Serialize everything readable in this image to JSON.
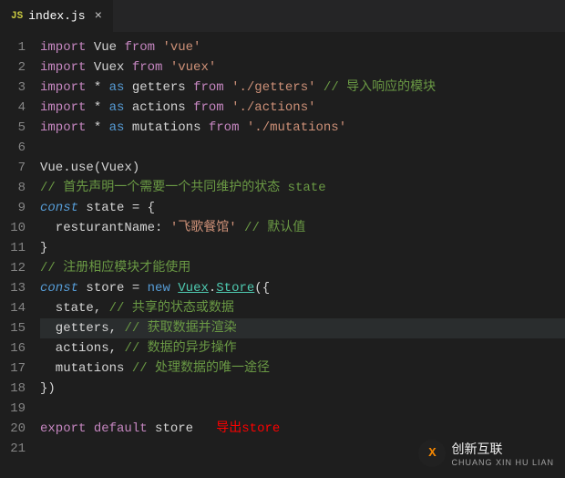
{
  "tab": {
    "icon": "JS",
    "filename": "index.js"
  },
  "lines": [
    {
      "n": 1,
      "tokens": [
        [
          "kw-import",
          "import"
        ],
        [
          "ident",
          " Vue "
        ],
        [
          "kw-import",
          "from"
        ],
        [
          "string",
          " 'vue'"
        ]
      ]
    },
    {
      "n": 2,
      "tokens": [
        [
          "kw-import",
          "import"
        ],
        [
          "ident",
          " Vuex "
        ],
        [
          "kw-import",
          "from"
        ],
        [
          "string",
          " 'vuex'"
        ]
      ]
    },
    {
      "n": 3,
      "tokens": [
        [
          "kw-import",
          "import"
        ],
        [
          "punct",
          " * "
        ],
        [
          "kw-as",
          "as"
        ],
        [
          "ident",
          " getters "
        ],
        [
          "kw-import",
          "from"
        ],
        [
          "string",
          " './getters'"
        ],
        [
          "comment",
          " // 导入响应的模块"
        ]
      ]
    },
    {
      "n": 4,
      "tokens": [
        [
          "kw-import",
          "import"
        ],
        [
          "punct",
          " * "
        ],
        [
          "kw-as",
          "as"
        ],
        [
          "ident",
          " actions "
        ],
        [
          "kw-import",
          "from"
        ],
        [
          "string",
          " './actions'"
        ]
      ]
    },
    {
      "n": 5,
      "tokens": [
        [
          "kw-import",
          "import"
        ],
        [
          "punct",
          " * "
        ],
        [
          "kw-as",
          "as"
        ],
        [
          "ident",
          " mutations "
        ],
        [
          "kw-import",
          "from"
        ],
        [
          "string",
          " './mutations'"
        ]
      ]
    },
    {
      "n": 6,
      "tokens": []
    },
    {
      "n": 7,
      "tokens": [
        [
          "ident",
          "Vue"
        ],
        [
          "punct",
          "."
        ],
        [
          "ident",
          "use"
        ],
        [
          "punct",
          "(Vuex)"
        ]
      ]
    },
    {
      "n": 8,
      "tokens": [
        [
          "comment",
          "// 首先声明一个需要一个共同维护的状态 state"
        ]
      ]
    },
    {
      "n": 9,
      "tokens": [
        [
          "kw-const",
          "const"
        ],
        [
          "ident",
          " state "
        ],
        [
          "punct",
          "= {"
        ]
      ]
    },
    {
      "n": 10,
      "tokens": [
        [
          "ident",
          "  resturantName"
        ],
        [
          "punct",
          ": "
        ],
        [
          "string",
          "'飞歌餐馆'"
        ],
        [
          "comment",
          " // 默认值"
        ]
      ]
    },
    {
      "n": 11,
      "tokens": [
        [
          "punct",
          "}"
        ]
      ]
    },
    {
      "n": 12,
      "tokens": [
        [
          "comment",
          "// 注册相应模块才能使用"
        ]
      ]
    },
    {
      "n": 13,
      "tokens": [
        [
          "kw-const",
          "const"
        ],
        [
          "ident",
          " store "
        ],
        [
          "punct",
          "= "
        ],
        [
          "kw-new",
          "new"
        ],
        [
          "punct",
          " "
        ],
        [
          "class-name",
          "Vuex"
        ],
        [
          "punct",
          "."
        ],
        [
          "prop-store",
          "Store"
        ],
        [
          "punct",
          "({"
        ]
      ]
    },
    {
      "n": 14,
      "tokens": [
        [
          "ident",
          "  state"
        ],
        [
          "punct",
          ", "
        ],
        [
          "comment",
          "// 共享的状态或数据"
        ]
      ]
    },
    {
      "n": 15,
      "highlighted": true,
      "tokens": [
        [
          "ident",
          "  getters"
        ],
        [
          "punct",
          ", "
        ],
        [
          "comment",
          "// 获取数据并渲染"
        ]
      ]
    },
    {
      "n": 16,
      "tokens": [
        [
          "ident",
          "  actions"
        ],
        [
          "punct",
          ", "
        ],
        [
          "comment",
          "// 数据的异步操作"
        ]
      ]
    },
    {
      "n": 17,
      "tokens": [
        [
          "ident",
          "  mutations "
        ],
        [
          "comment",
          "// 处理数据的唯一途径"
        ]
      ]
    },
    {
      "n": 18,
      "tokens": [
        [
          "punct",
          "})"
        ]
      ]
    },
    {
      "n": 19,
      "tokens": []
    },
    {
      "n": 20,
      "tokens": [
        [
          "kw-export",
          "export"
        ],
        [
          "punct",
          " "
        ],
        [
          "kw-export",
          "default"
        ],
        [
          "ident",
          " store   "
        ],
        [
          "annot",
          "导出store"
        ]
      ]
    },
    {
      "n": 21,
      "tokens": []
    }
  ],
  "watermark": {
    "logo_text": "X",
    "brand": "创新互联",
    "sub": "CHUANG XIN HU LIAN"
  }
}
